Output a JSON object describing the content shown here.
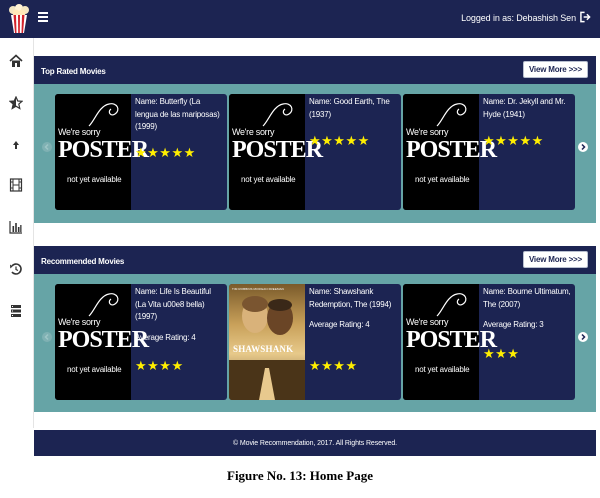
{
  "header": {
    "logo_icon": "popcorn-icon",
    "menu_icon": "hamburger-menu-icon",
    "login_text": "Logged in as: Debashish Sen",
    "logout_icon": "sign-out-icon"
  },
  "sidebar": {
    "items": [
      {
        "icon": "home-icon"
      },
      {
        "icon": "star-half-icon"
      },
      {
        "icon": "arrow-up-icon"
      },
      {
        "icon": "film-icon"
      },
      {
        "icon": "bar-chart-icon"
      },
      {
        "icon": "history-icon"
      },
      {
        "icon": "server-icon"
      }
    ]
  },
  "top_rated": {
    "title": "Top Rated Movies",
    "view_more": "View More >>>",
    "movies": [
      {
        "name": "Name: Butterfly (La lengua de las mariposas) (1999)",
        "stars": 5,
        "star_text": "★★★★★"
      },
      {
        "name": "Name: Good Earth, The (1937)",
        "stars": 5,
        "star_text": "★★★★★"
      },
      {
        "name": "Name: Dr. Jekyll and Mr. Hyde (1941)",
        "stars": 5,
        "star_text": "★★★★★"
      }
    ]
  },
  "recommended": {
    "title": "Recommended Movies",
    "view_more": "View More >>>",
    "movies": [
      {
        "name": "Name: Life Is Beautiful (La Vita u00e8 bella) (1997)",
        "avg": "Average Rating: 4",
        "stars": 4,
        "star_text": "★★★★"
      },
      {
        "name": "Name: Shawshank Redemption, The (1994)",
        "avg": "Average Rating: 4",
        "stars": 4,
        "star_text": "★★★★"
      },
      {
        "name": "Name: Bourne Ultimatum, The (2007)",
        "avg": "Average Rating: 3",
        "stars": 3,
        "star_text": "★★★"
      }
    ]
  },
  "placeholder_poster": {
    "line1": "We're sorry",
    "line2": "POSTER",
    "line3": "not yet available"
  },
  "shawshank_poster": {
    "cast": "TIM ROBBINS   MORGAN FREEMAN",
    "title": "SHAWSHANK"
  },
  "footer": {
    "copyright": "© Movie Recommendation, 2017. All Rights Reserved."
  },
  "caption": "Figure No. 13: Home Page",
  "colors": {
    "navy": "#1c2452",
    "teal": "#66a4a6",
    "star": "#ffee00"
  }
}
